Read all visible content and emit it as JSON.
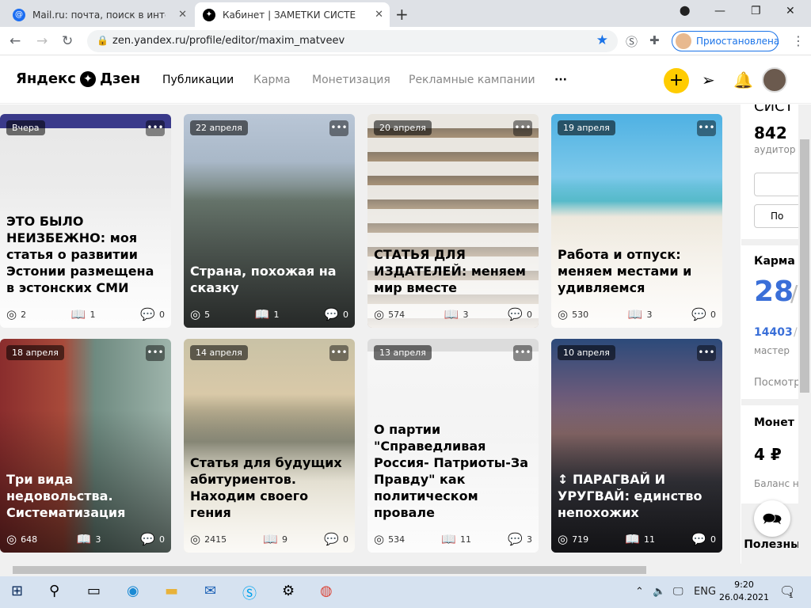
{
  "browser": {
    "tabs": [
      {
        "title": "Mail.ru: почта, поиск в интернете",
        "active": false
      },
      {
        "title": "Кабинет | ЗАМЕТКИ СИСТЕМАТИ",
        "active": true
      }
    ],
    "new_tab_label": "+",
    "url": "zen.yandex.ru/profile/editor/maxim_matveev",
    "profile_label": "Приостановлена"
  },
  "header": {
    "logo_text": "Яндекс",
    "logo_text2": "Дзен",
    "nav": [
      "Публикации",
      "Карма",
      "Монетизация",
      "Рекламные кампании"
    ],
    "more_label": "···",
    "plus_label": "+"
  },
  "cards": [
    {
      "date": "Вчера",
      "title": "ЭТО БЫЛО НЕИЗБЕЖНО: моя статья о развитии Эстонии размещена в эстонских СМИ",
      "views": "2",
      "reads": "1",
      "comments": "0"
    },
    {
      "date": "22 апреля",
      "title": "Страна, похожая на сказку",
      "views": "5",
      "reads": "1",
      "comments": "0"
    },
    {
      "date": "20 апреля",
      "title": "СТАТЬЯ ДЛЯ ИЗДАТЕЛЕЙ: меняем мир вместе",
      "views": "574",
      "reads": "3",
      "comments": "0"
    },
    {
      "date": "19 апреля",
      "title": "Работа и отпуск: меняем местами и удивляемся",
      "views": "530",
      "reads": "3",
      "comments": "0"
    },
    {
      "date": "18 апреля",
      "title": "Три вида недовольства. Систематизация",
      "views": "648",
      "reads": "3",
      "comments": "0"
    },
    {
      "date": "14 апреля",
      "title": "Статья для будущих абитуриентов. Находим своего гения",
      "views": "2415",
      "reads": "9",
      "comments": "0"
    },
    {
      "date": "13 апреля",
      "title": "О партии \"Справедливая Россия- Патриоты-За Правду\" как политическом провале",
      "views": "534",
      "reads": "11",
      "comments": "3"
    },
    {
      "date": "10 апреля",
      "title": "↕ ПАРАГВАЙ И УРУГВАЙ: единство непохожих",
      "views": "719",
      "reads": "11",
      "comments": "0"
    }
  ],
  "sidebar": {
    "top_cut": "СИСТ",
    "audience_num": "842",
    "audience_label": "аудитор",
    "btn2": "По",
    "karma_label": "Карма",
    "karma_value": "28",
    "karma_sep": "/",
    "master_value": "14403",
    "master_sep": "/",
    "master_label": "мастер",
    "view_label": "Посмотр",
    "money_label": "Монет",
    "money_value": "4 ₽",
    "balance_label": "Баланс н"
  },
  "useful_label": "Полезны",
  "taskbar": {
    "lang": "ENG",
    "time": "9:20",
    "date": "26.04.2021",
    "notif": "1"
  }
}
